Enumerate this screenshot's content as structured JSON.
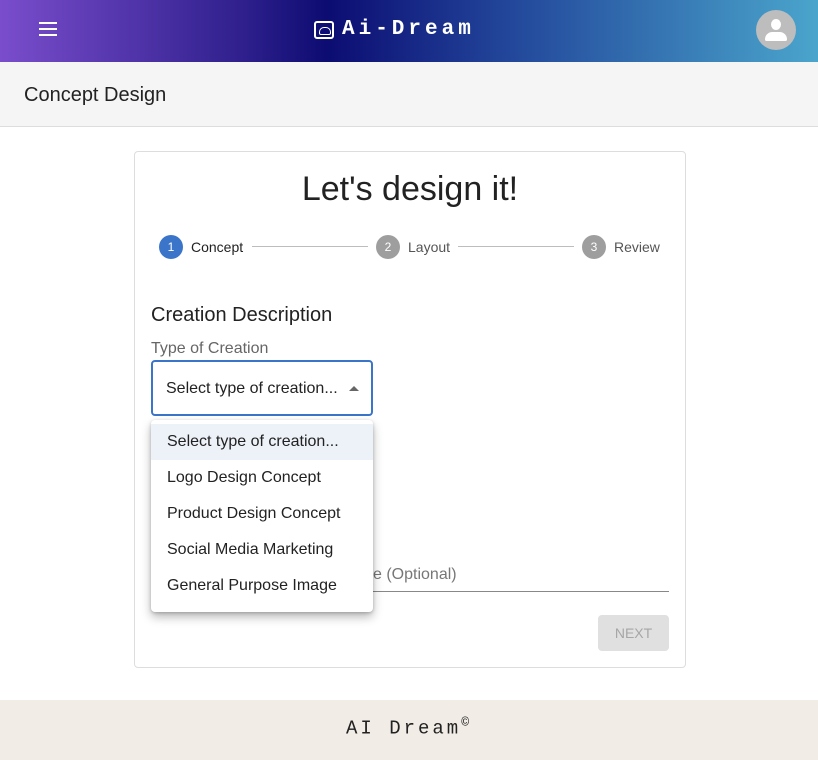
{
  "header": {
    "brand": "Ai-Dream",
    "menu_icon": "hamburger-icon",
    "avatar_icon": "user-icon",
    "gradient": [
      "#7a4dcc",
      "#0c0c72",
      "#4aa5cc"
    ]
  },
  "subheader": {
    "title": "Concept Design"
  },
  "card": {
    "title": "Let's design it!",
    "steps": [
      {
        "num": "1",
        "label": "Concept",
        "active": true
      },
      {
        "num": "2",
        "label": "Layout",
        "active": false
      },
      {
        "num": "3",
        "label": "Review",
        "active": false
      }
    ],
    "section_title": "Creation Description",
    "type_label": "Type of Creation",
    "type_value": "Select type of creation...",
    "second_field_label_visible": "e (Optional)",
    "next_label": "NEXT"
  },
  "dropdown": {
    "options": [
      "Select type of creation...",
      "Logo Design Concept",
      "Product Design Concept",
      "Social Media Marketing",
      "General Purpose Image"
    ],
    "selected": 0
  },
  "footer": {
    "text": "AI Dream",
    "mark": "©"
  },
  "colors": {
    "accent": "#3a75c9",
    "footer_bg": "#f1ede6"
  }
}
